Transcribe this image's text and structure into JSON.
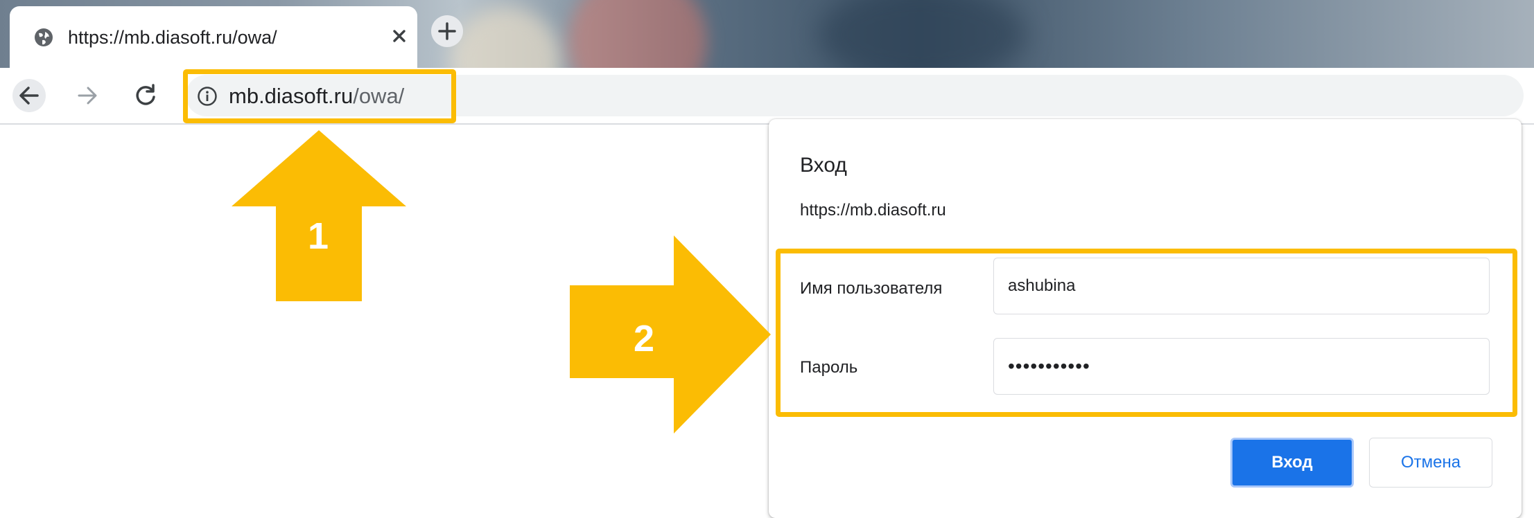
{
  "browser": {
    "tab": {
      "title": "https://mb.diasoft.ru/owa/",
      "favicon_icon": "globe-icon",
      "close_icon": "close-icon"
    },
    "new_tab_icon": "plus-icon",
    "nav": {
      "back_icon": "arrow-left-icon",
      "forward_icon": "arrow-right-icon",
      "reload_icon": "reload-icon"
    },
    "address_bar": {
      "info_icon": "info-icon",
      "host": "mb.diasoft.ru",
      "path": "/owa/"
    }
  },
  "annotations": {
    "arrow_1_number": "1",
    "arrow_2_number": "2",
    "color": "#fbbc04"
  },
  "dialog": {
    "title": "Вход",
    "origin": "https://mb.diasoft.ru",
    "username_label": "Имя пользователя",
    "username_value": "ashubina",
    "password_label": "Пароль",
    "password_value": "•••••••••••",
    "submit_label": "Вход",
    "cancel_label": "Отмена"
  },
  "colors": {
    "accent": "#1a73e8",
    "highlight": "#fbbc04"
  }
}
